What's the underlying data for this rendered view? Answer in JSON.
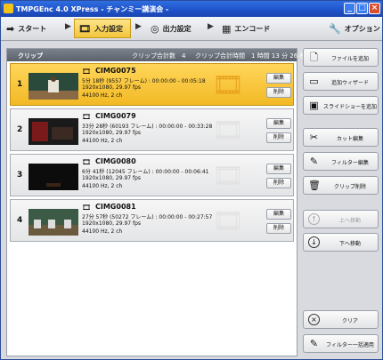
{
  "window": {
    "title": "TMPGEnc 4.0 XPress - チャンミー講演会 -",
    "min": "_",
    "max": "□",
    "close": "×"
  },
  "toolbar": {
    "start": "スタート",
    "input": "入力設定",
    "output": "出力設定",
    "encode": "エンコード",
    "options": "オプション",
    "arrow": "▶"
  },
  "list": {
    "header_label": "クリップ",
    "clip_count": "クリップ合計数　4",
    "clip_time": "クリップ合計時間　1 時間 13 分 26 秒"
  },
  "clips": [
    {
      "num": "1",
      "name": "CIMG0075",
      "duration": "5分 18秒 (9557 フレーム)  :  00:00:00 - 00:05:18",
      "resolution": "1920x1080,  29.97 fps",
      "audio": "44100 Hz,  2 ch",
      "edit": "編集",
      "delete": "削除"
    },
    {
      "num": "2",
      "name": "CIMG0079",
      "duration": "33分 28秒 (60193 フレーム)  :  00:00:00 - 00:33:28",
      "resolution": "1920x1080,  29.97 fps",
      "audio": "44100 Hz,  2 ch",
      "edit": "編集",
      "delete": "削除"
    },
    {
      "num": "3",
      "name": "CIMG0080",
      "duration": "6分 41秒 (12045 フレーム)  :  00:00:00 - 00:06:41",
      "resolution": "1920x1080,  29.97 fps",
      "audio": "44100 Hz,  2 ch",
      "edit": "編集",
      "delete": "削除"
    },
    {
      "num": "4",
      "name": "CIMG0081",
      "duration": "27分 57秒 (50272 フレーム)  :  00:00:00 - 00:27:57",
      "resolution": "1920x1080,  29.97 fps",
      "audio": "44100 Hz,  2 ch",
      "edit": "編集",
      "delete": "削除"
    }
  ],
  "side": {
    "add_file": "ファイルを追加",
    "add_wizard": "追加ウィザード",
    "add_slideshow": "スライドショーを追加",
    "cut_edit": "カット編集",
    "filter_edit": "フィルター編集",
    "clip_delete": "クリップ削除",
    "move_up": "上へ移動",
    "move_down": "下へ移動",
    "clear": "クリア",
    "filter_apply_all": "フィルター一括適用"
  }
}
